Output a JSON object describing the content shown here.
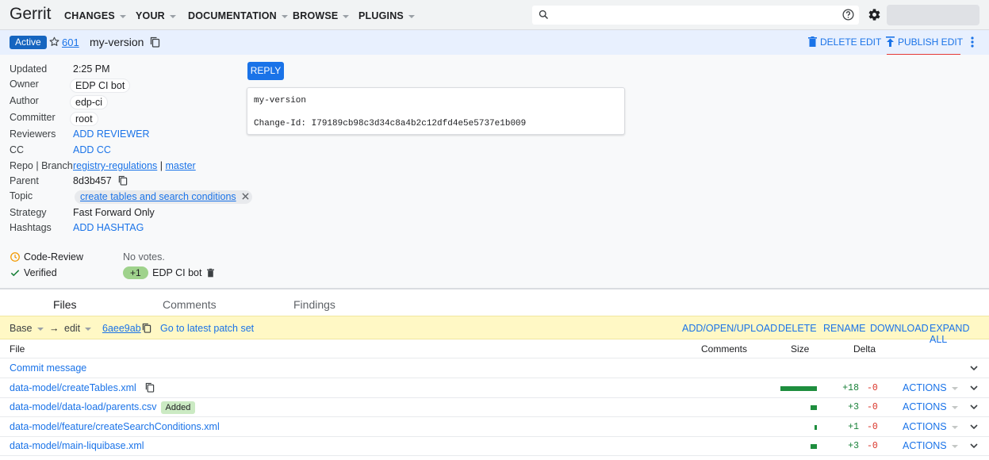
{
  "header": {
    "logo": "Gerrit",
    "nav": [
      "CHANGES",
      "YOUR",
      "DOCUMENTATION",
      "BROWSE",
      "PLUGINS"
    ],
    "search_value": ""
  },
  "change": {
    "status": "Active",
    "number": "601",
    "subject": "my-version",
    "delete_edit": "DELETE EDIT",
    "publish_edit": "PUBLISH EDIT"
  },
  "meta": {
    "updated_label": "Updated",
    "updated_value": "2:25 PM",
    "owner_label": "Owner",
    "owner_value": "EDP CI bot",
    "author_label": "Author",
    "author_value": "edp-ci",
    "committer_label": "Committer",
    "committer_value": "root",
    "reviewers_label": "Reviewers",
    "reviewers_value": "ADD REVIEWER",
    "cc_label": "CC",
    "cc_value": "ADD CC",
    "repo_label": "Repo | Branch",
    "repo_value": "registry-regulations",
    "repo_sep": "|",
    "branch_value": "master",
    "parent_label": "Parent",
    "parent_value": "8d3b457",
    "topic_label": "Topic",
    "topic_value": "create tables and search conditions",
    "strategy_label": "Strategy",
    "strategy_value": "Fast Forward Only",
    "hashtags_label": "Hashtags",
    "hashtags_value": "ADD HASHTAG"
  },
  "reply_label": "REPLY",
  "commit_message": {
    "line1": "my-version",
    "line2": "Change-Id: I79189cb98c3d34c8a4b2c12dfd4e5e5737e1b009"
  },
  "labels": {
    "code_review": "Code-Review",
    "code_review_votes": "No votes.",
    "verified": "Verified",
    "verified_vote": "+1",
    "verified_voter": "EDP CI bot"
  },
  "tabs": [
    "Files",
    "Comments",
    "Findings"
  ],
  "patchset": {
    "base": "Base",
    "arrow": "→",
    "edit": "edit",
    "commit": "6aee9ab",
    "latest": "Go to latest patch set",
    "actions": [
      "ADD/OPEN/UPLOAD",
      "DELETE",
      "RENAME",
      "DOWNLOAD",
      "EXPAND ALL"
    ]
  },
  "file_table": {
    "headers": {
      "file": "File",
      "comments": "Comments",
      "size": "Size",
      "delta": "Delta"
    },
    "commit_message_row": "Commit message",
    "action_label": "ACTIONS",
    "files": [
      {
        "name": "data-model/createTables.xml",
        "plus": "+18",
        "minus": "-0",
        "size_fraction": 1.0,
        "badge": ""
      },
      {
        "name": "data-model/data-load/parents.csv",
        "plus": "+3",
        "minus": "-0",
        "size_fraction": 0.17,
        "badge": "Added"
      },
      {
        "name": "data-model/feature/createSearchConditions.xml",
        "plus": "+1",
        "minus": "-0",
        "size_fraction": 0.06,
        "badge": ""
      },
      {
        "name": "data-model/main-liquibase.xml",
        "plus": "+3",
        "minus": "-0",
        "size_fraction": 0.17,
        "badge": ""
      }
    ]
  }
}
